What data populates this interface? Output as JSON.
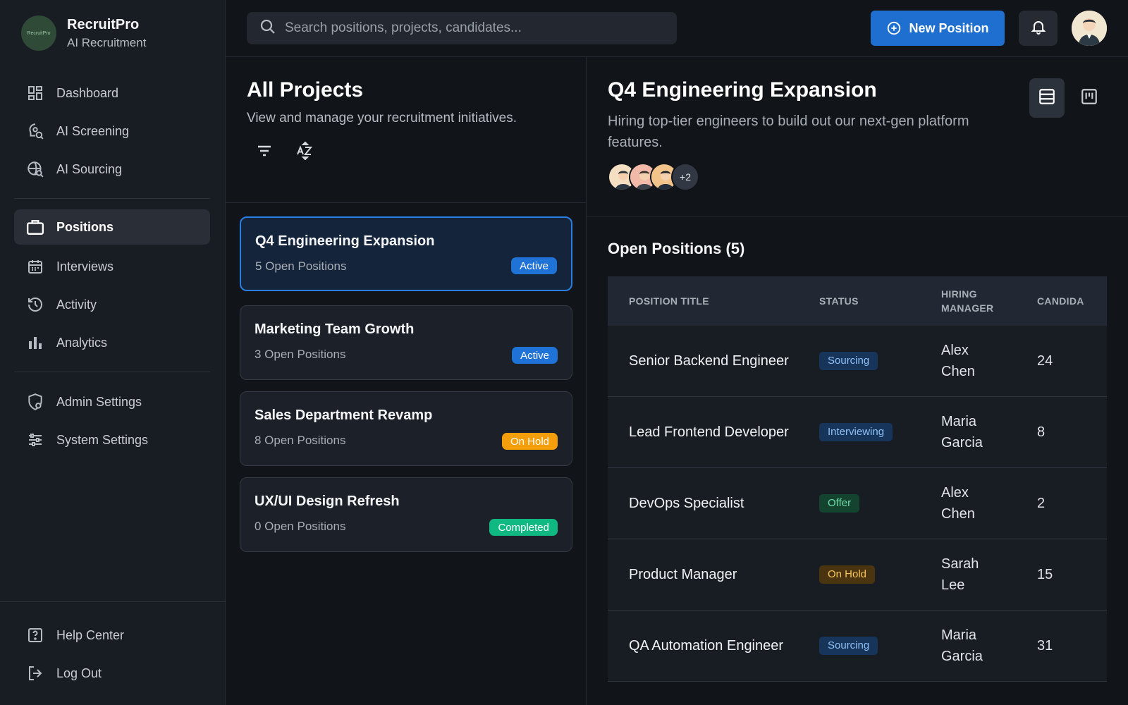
{
  "brand": {
    "name": "RecruitPro",
    "subtitle": "AI Recruitment",
    "logo_text": "RecruitPro"
  },
  "sidebar": {
    "items": [
      {
        "label": "Dashboard",
        "icon": "dashboard-icon"
      },
      {
        "label": "AI Screening",
        "icon": "ai-screening-icon"
      },
      {
        "label": "AI Sourcing",
        "icon": "ai-sourcing-icon"
      },
      {
        "label": "Positions",
        "icon": "briefcase-icon",
        "active": true
      },
      {
        "label": "Interviews",
        "icon": "calendar-icon"
      },
      {
        "label": "Activity",
        "icon": "history-icon"
      },
      {
        "label": "Analytics",
        "icon": "bar-chart-icon"
      },
      {
        "label": "Admin Settings",
        "icon": "shield-gear-icon"
      },
      {
        "label": "System Settings",
        "icon": "sliders-icon"
      }
    ],
    "footer": [
      {
        "label": "Help Center",
        "icon": "help-icon"
      },
      {
        "label": "Log Out",
        "icon": "logout-icon"
      }
    ]
  },
  "topbar": {
    "search_placeholder": "Search positions, projects, candidates...",
    "new_button": "New Position"
  },
  "projects": {
    "title": "All Projects",
    "subtitle": "View and manage your recruitment initiatives.",
    "list": [
      {
        "title": "Q4 Engineering Expansion",
        "sub": "5 Open Positions",
        "status": "Active",
        "selected": true
      },
      {
        "title": "Marketing Team Growth",
        "sub": "3 Open Positions",
        "status": "Active"
      },
      {
        "title": "Sales Department Revamp",
        "sub": "8 Open Positions",
        "status": "On Hold"
      },
      {
        "title": "UX/UI Design Refresh",
        "sub": "0 Open Positions",
        "status": "Completed"
      }
    ]
  },
  "detail": {
    "title": "Q4 Engineering Expansion",
    "description": "Hiring top-tier engineers to build out our next-gen platform features.",
    "team_more": "+2",
    "open_title": "Open Positions (5)",
    "columns": [
      "POSITION TITLE",
      "STATUS",
      "HIRING MANAGER",
      "CANDIDA"
    ],
    "rows": [
      {
        "title": "Senior Backend Engineer",
        "status": "Sourcing",
        "manager_first": "Alex",
        "manager_last": "Chen",
        "candidates": "24"
      },
      {
        "title": "Lead Frontend Developer",
        "status": "Interviewing",
        "manager_first": "Maria",
        "manager_last": "Garcia",
        "candidates": "8"
      },
      {
        "title": "DevOps Specialist",
        "status": "Offer",
        "manager_first": "Alex",
        "manager_last": "Chen",
        "candidates": "2"
      },
      {
        "title": "Product Manager",
        "status": "On Hold",
        "manager_first": "Sarah",
        "manager_last": "Lee",
        "candidates": "15"
      },
      {
        "title": "QA Automation Engineer",
        "status": "Sourcing",
        "manager_first": "Maria",
        "manager_last": "Garcia",
        "candidates": "31"
      }
    ]
  },
  "colors": {
    "accent": "#1f6fd1",
    "active": "#1f72d6",
    "hold": "#f59e0b",
    "done": "#10b981",
    "bg": "#111418",
    "sidebar": "#181c23"
  }
}
